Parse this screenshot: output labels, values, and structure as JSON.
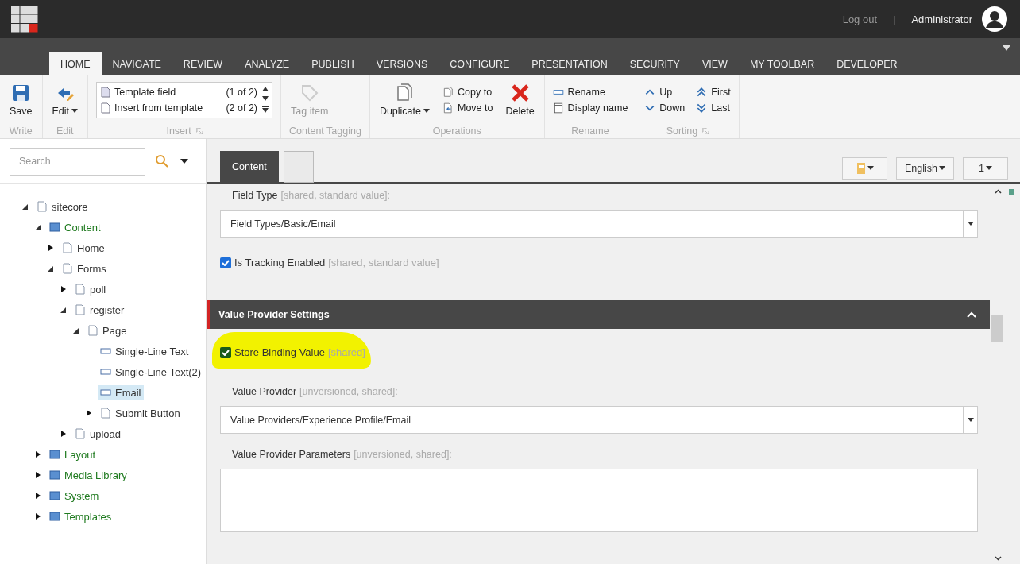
{
  "header": {
    "logout": "Log out",
    "separator": "|",
    "user": "Administrator"
  },
  "nav_tabs": [
    {
      "label": "HOME",
      "selected": true
    },
    {
      "label": "NAVIGATE",
      "selected": false
    },
    {
      "label": "REVIEW",
      "selected": false
    },
    {
      "label": "ANALYZE",
      "selected": false
    },
    {
      "label": "PUBLISH",
      "selected": false
    },
    {
      "label": "VERSIONS",
      "selected": false
    },
    {
      "label": "CONFIGURE",
      "selected": false
    },
    {
      "label": "PRESENTATION",
      "selected": false
    },
    {
      "label": "SECURITY",
      "selected": false
    },
    {
      "label": "VIEW",
      "selected": false
    },
    {
      "label": "MY TOOLBAR",
      "selected": false
    },
    {
      "label": "DEVELOPER",
      "selected": false
    }
  ],
  "ribbon": [
    {
      "label": "Write",
      "launcher": false,
      "columns": [
        [
          {
            "kind": "large",
            "label": "Save",
            "dropdown": false,
            "disabled": false
          }
        ]
      ]
    },
    {
      "label": "Edit",
      "launcher": false,
      "columns": [
        [
          {
            "kind": "large",
            "label": "Edit",
            "dropdown": true,
            "disabled": false
          }
        ]
      ]
    },
    {
      "label": "Insert",
      "launcher": true,
      "gallery": [
        {
          "label": "Template field",
          "count": "(1 of 2)"
        },
        {
          "label": "Insert from template",
          "count": "(2 of 2)"
        }
      ]
    },
    {
      "label": "Content Tagging",
      "launcher": false,
      "columns": [
        [
          {
            "kind": "large",
            "label": "Tag item",
            "dropdown": false,
            "disabled": true
          }
        ]
      ]
    },
    {
      "label": "Operations",
      "launcher": false,
      "columns": [
        [
          {
            "kind": "large",
            "label": "Duplicate",
            "dropdown": true,
            "disabled": false
          }
        ],
        [
          {
            "kind": "small",
            "label": "Copy to"
          },
          {
            "kind": "small",
            "label": "Move to"
          }
        ],
        [
          {
            "kind": "large",
            "label": "Delete",
            "dropdown": false,
            "disabled": false
          }
        ]
      ]
    },
    {
      "label": "Rename",
      "launcher": false,
      "columns": [
        [
          {
            "kind": "small",
            "label": "Rename"
          },
          {
            "kind": "small",
            "label": "Display name"
          }
        ]
      ]
    },
    {
      "label": "Sorting",
      "launcher": true,
      "columns": [
        [
          {
            "kind": "small",
            "label": "Up"
          },
          {
            "kind": "small",
            "label": "Down"
          }
        ],
        [
          {
            "kind": "small",
            "label": "First"
          },
          {
            "kind": "small",
            "label": "Last"
          }
        ]
      ]
    }
  ],
  "search": {
    "placeholder": "Search"
  },
  "tree": [
    {
      "label": "sitecore",
      "kind": "node",
      "expanded": true,
      "selected": false,
      "children": [
        {
          "label": "Content",
          "kind": "section",
          "expanded": true,
          "selected": false,
          "children": [
            {
              "label": "Home",
              "kind": "node",
              "expanded": false,
              "selected": false
            },
            {
              "label": "Forms",
              "kind": "node",
              "expanded": true,
              "selected": false,
              "children": [
                {
                  "label": "poll",
                  "kind": "node",
                  "expanded": false,
                  "selected": false
                },
                {
                  "label": "register",
                  "kind": "node",
                  "expanded": true,
                  "selected": false,
                  "children": [
                    {
                      "label": "Page",
                      "kind": "node",
                      "expanded": true,
                      "selected": false,
                      "children": [
                        {
                          "label": "Single-Line Text",
                          "kind": "leaf",
                          "selected": false
                        },
                        {
                          "label": "Single-Line Text(2)",
                          "kind": "leaf",
                          "selected": false
                        },
                        {
                          "label": "Email",
                          "kind": "leaf",
                          "selected": true
                        },
                        {
                          "label": "Submit Button",
                          "kind": "node",
                          "expanded": false,
                          "selected": false
                        }
                      ]
                    }
                  ]
                },
                {
                  "label": "upload",
                  "kind": "node",
                  "expanded": false,
                  "selected": false
                }
              ]
            }
          ]
        },
        {
          "label": "Layout",
          "kind": "section",
          "expanded": false,
          "selected": false
        },
        {
          "label": "Media Library",
          "kind": "section",
          "expanded": false,
          "selected": false
        },
        {
          "label": "System",
          "kind": "section",
          "expanded": false,
          "selected": false
        },
        {
          "label": "Templates",
          "kind": "section",
          "expanded": false,
          "selected": false
        }
      ]
    }
  ],
  "editor_tabs": [
    {
      "label": "Content",
      "selected": true
    },
    {
      "selected": false
    }
  ],
  "editor_buttons": [
    {
      "kind": "icon"
    },
    {
      "kind": "text",
      "label": "English"
    },
    {
      "kind": "text",
      "label": "1"
    }
  ],
  "fields": [
    {
      "kind": "dropdown",
      "label": "Field Type",
      "hint": "[shared, standard value]:",
      "value": "Field Types/Basic/Email"
    },
    {
      "kind": "checkbox",
      "label": "Is Tracking Enabled",
      "hint": "[shared, standard value]",
      "checked": true,
      "highlighted": false
    },
    {
      "kind": "section",
      "label": "Value Provider Settings",
      "expanded": true
    },
    {
      "kind": "checkbox",
      "label": "Store Binding Value",
      "hint": "[shared]",
      "checked": true,
      "highlighted": true
    },
    {
      "kind": "dropdown",
      "label": "Value Provider",
      "hint": "[unversioned, shared]:",
      "value": "Value Providers/Experience Profile/Email"
    },
    {
      "kind": "textarea",
      "label": "Value Provider Parameters",
      "hint": "[unversioned, shared]:"
    }
  ]
}
